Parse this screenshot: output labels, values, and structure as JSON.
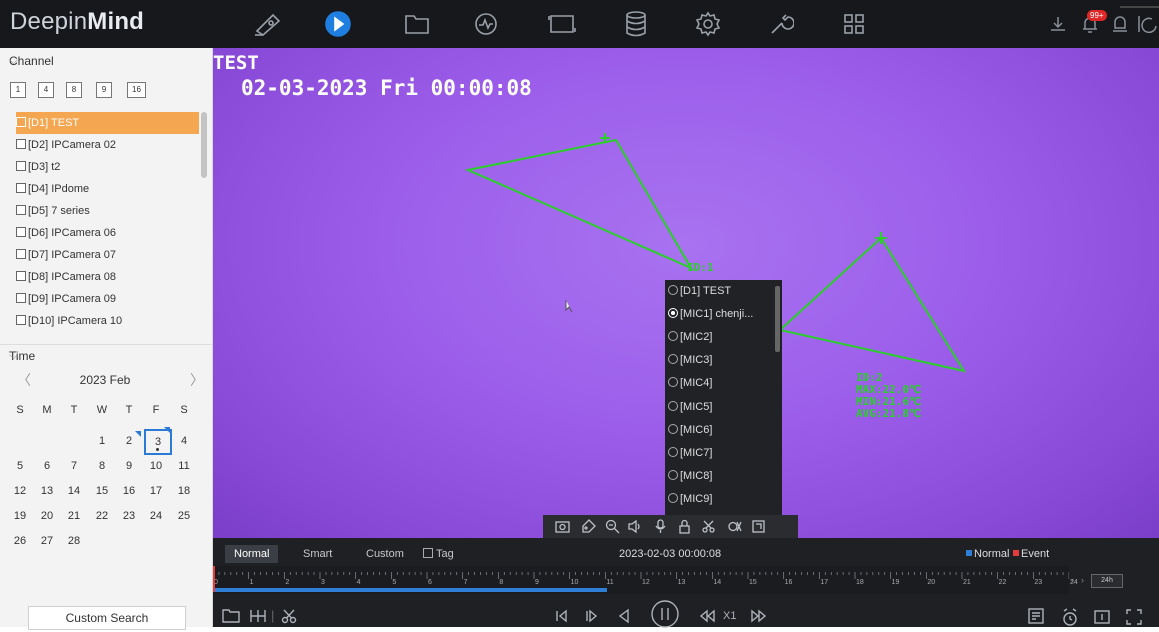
{
  "app": {
    "logo_part1": "Deepin",
    "logo_part2": "Mind"
  },
  "topbar": {
    "nav_icons": [
      "camera-icon",
      "playback-icon",
      "file-icon",
      "smart-analysis-icon",
      "vca-icon",
      "storage-icon",
      "settings-icon",
      "maintenance-icon",
      "layout-icon"
    ],
    "active_icon": "playback-icon",
    "accent": "#1e7fe0",
    "notification_badge": "99+"
  },
  "channel_panel": {
    "title": "Channel",
    "layouts": [
      "1",
      "4",
      "8",
      "9",
      "16"
    ],
    "channels": [
      {
        "label": "[D1] TEST",
        "checked": true,
        "selected": true
      },
      {
        "label": "[D2] IPCamera 02",
        "checked": false
      },
      {
        "label": "[D3] t2",
        "checked": false
      },
      {
        "label": "[D4] IPdome",
        "checked": false
      },
      {
        "label": "[D5] 7 series",
        "checked": false
      },
      {
        "label": "[D6] IPCamera 06",
        "checked": false
      },
      {
        "label": "[D7] IPCamera 07",
        "checked": false
      },
      {
        "label": "[D8] IPCamera 08",
        "checked": false
      },
      {
        "label": "[D9] IPCamera 09",
        "checked": false
      },
      {
        "label": "[D10] IPCamera 10",
        "checked": false
      }
    ],
    "selection_color": "#f5a650"
  },
  "time_panel": {
    "title": "Time",
    "month_label": "2023 Feb",
    "weekdays": [
      "S",
      "M",
      "T",
      "W",
      "T",
      "F",
      "S"
    ],
    "days": [
      "1",
      "2",
      "3",
      "4",
      "5",
      "6",
      "7",
      "8",
      "9",
      "10",
      "11",
      "12",
      "13",
      "14",
      "15",
      "16",
      "17",
      "18",
      "19",
      "20",
      "21",
      "22",
      "23",
      "24",
      "25",
      "26",
      "27",
      "28"
    ],
    "first_weekday_index": 3,
    "selected_day": "3",
    "days_with_recording": [
      "2",
      "3"
    ],
    "custom_search_label": "Custom Search"
  },
  "video": {
    "osd_title": "TEST",
    "osd_datetime": "02-03-2023 Fri 00:00:08",
    "roi_1": {
      "id": "ID:1"
    },
    "roi_2": {
      "id": "ID:2",
      "max": "MAX:22.0℃",
      "min": "MIN:21.6℃",
      "avg": "AVG:21.8℃"
    },
    "roi_color": "#28d028"
  },
  "audio_dropdown": {
    "items": [
      {
        "label": "[D1] TEST",
        "selected": false
      },
      {
        "label": "[MIC1] chenji...",
        "selected": true
      },
      {
        "label": "[MIC2]",
        "selected": false
      },
      {
        "label": "[MIC3]",
        "selected": false
      },
      {
        "label": "[MIC4]",
        "selected": false
      },
      {
        "label": "[MIC5]",
        "selected": false
      },
      {
        "label": "[MIC6]",
        "selected": false
      },
      {
        "label": "[MIC7]",
        "selected": false
      },
      {
        "label": "[MIC8]",
        "selected": false
      },
      {
        "label": "[MIC9]",
        "selected": false
      }
    ]
  },
  "video_toolbar": {
    "icons": [
      "snapshot-icon",
      "tag-icon",
      "digital-zoom-icon",
      "audio-icon",
      "microphone-icon",
      "lock-icon",
      "clip-icon",
      "fisheye-icon",
      "fullscreen-window-icon"
    ]
  },
  "timeline": {
    "modes": [
      "Normal",
      "Smart",
      "Custom"
    ],
    "active_mode": "Normal",
    "tag_label": "Tag",
    "current_time": "2023-02-03 00:00:08",
    "legend_normal": "Normal",
    "legend_event": "Event",
    "normal_color": "#2e7ed6",
    "event_color": "#e43c3c",
    "hours": [
      "0",
      "1",
      "2",
      "3",
      "4",
      "5",
      "6",
      "7",
      "8",
      "9",
      "10",
      "11",
      "12",
      "13",
      "14",
      "15",
      "16",
      "17",
      "18",
      "19",
      "20",
      "21",
      "22",
      "23",
      "24"
    ],
    "recorded_fraction": 0.46,
    "zoom": "24h",
    "playback_speed": "X1"
  }
}
